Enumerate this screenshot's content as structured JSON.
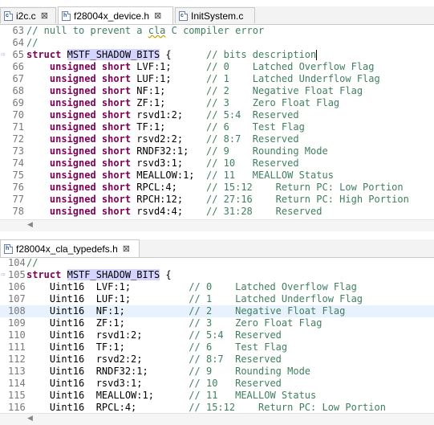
{
  "top_tabs": [
    {
      "label": "i2c.c",
      "icon": "c-file-icon",
      "has_close": true,
      "active": false
    },
    {
      "label": "f28004x_device.h",
      "icon": "h-file-icon",
      "has_close": true,
      "active": true
    },
    {
      "label": "InitSystem.c",
      "icon": "c-file-icon",
      "has_close": false,
      "active": false
    }
  ],
  "bottom_tab": {
    "label": "f28004x_cla_typedefs.h",
    "icon": "h-file-icon",
    "has_close": true
  },
  "close_glyph": "⊠",
  "top_editor": [
    {
      "n": "63",
      "parts": [
        [
          "cm",
          "// null to prevent a "
        ],
        [
          "cmsq",
          "cla"
        ],
        [
          "cm",
          " C compiler error"
        ]
      ]
    },
    {
      "n": "64",
      "parts": [
        [
          "cm",
          "//"
        ]
      ]
    },
    {
      "n": "65",
      "marker": true,
      "parts": [
        [
          "kw",
          "struct"
        ],
        [
          "",
          " "
        ],
        [
          "sel",
          "MSTF_SHADOW_BITS"
        ],
        [
          "",
          " {      "
        ],
        [
          "cm",
          "// bits description"
        ],
        [
          "caret",
          ""
        ]
      ]
    },
    {
      "n": "66",
      "parts": [
        [
          "",
          "    "
        ],
        [
          "kw",
          "unsigned short"
        ],
        [
          "",
          " LVF:1;      "
        ],
        [
          "cm",
          "// 0    Latched Overflow Flag"
        ]
      ]
    },
    {
      "n": "67",
      "parts": [
        [
          "",
          "    "
        ],
        [
          "kw",
          "unsigned short"
        ],
        [
          "",
          " LUF:1;      "
        ],
        [
          "cm",
          "// 1    Latched Underflow Flag"
        ]
      ]
    },
    {
      "n": "68",
      "parts": [
        [
          "",
          "    "
        ],
        [
          "kw",
          "unsigned short"
        ],
        [
          "",
          " NF:1;       "
        ],
        [
          "cm",
          "// 2    Negative Float Flag"
        ]
      ]
    },
    {
      "n": "69",
      "parts": [
        [
          "",
          "    "
        ],
        [
          "kw",
          "unsigned short"
        ],
        [
          "",
          " ZF:1;       "
        ],
        [
          "cm",
          "// 3    Zero Float Flag"
        ]
      ]
    },
    {
      "n": "70",
      "parts": [
        [
          "",
          "    "
        ],
        [
          "kw",
          "unsigned short"
        ],
        [
          "",
          " rsvd1:2;    "
        ],
        [
          "cm",
          "// 5:4  Reserved"
        ]
      ]
    },
    {
      "n": "71",
      "parts": [
        [
          "",
          "    "
        ],
        [
          "kw",
          "unsigned short"
        ],
        [
          "",
          " TF:1;       "
        ],
        [
          "cm",
          "// 6    Test Flag"
        ]
      ]
    },
    {
      "n": "72",
      "parts": [
        [
          "",
          "    "
        ],
        [
          "kw",
          "unsigned short"
        ],
        [
          "",
          " rsvd2:2;    "
        ],
        [
          "cm",
          "// 8:7  Reserved"
        ]
      ]
    },
    {
      "n": "73",
      "parts": [
        [
          "",
          "    "
        ],
        [
          "kw",
          "unsigned short"
        ],
        [
          "",
          " RNDF32:1;   "
        ],
        [
          "cm",
          "// 9    Rounding Mode"
        ]
      ]
    },
    {
      "n": "74",
      "parts": [
        [
          "",
          "    "
        ],
        [
          "kw",
          "unsigned short"
        ],
        [
          "",
          " rsvd3:1;    "
        ],
        [
          "cm",
          "// 10   Reserved"
        ]
      ]
    },
    {
      "n": "75",
      "parts": [
        [
          "",
          "    "
        ],
        [
          "kw",
          "unsigned short"
        ],
        [
          "",
          " MEALLOW:1;  "
        ],
        [
          "cm",
          "// 11   MEALLOW Status"
        ]
      ]
    },
    {
      "n": "76",
      "parts": [
        [
          "",
          "    "
        ],
        [
          "kw",
          "unsigned short"
        ],
        [
          "",
          " RPCL:4;     "
        ],
        [
          "cm",
          "// 15:12    Return PC: Low Portion"
        ]
      ]
    },
    {
      "n": "77",
      "parts": [
        [
          "",
          "    "
        ],
        [
          "kw",
          "unsigned short"
        ],
        [
          "",
          " RPCH:12;    "
        ],
        [
          "cm",
          "// 27:16    Return PC: High Portion"
        ]
      ]
    },
    {
      "n": "78",
      "parts": [
        [
          "",
          "    "
        ],
        [
          "kw",
          "unsigned short"
        ],
        [
          "",
          " rsvd4:4;    "
        ],
        [
          "cm",
          "// 31:28    Reserved"
        ]
      ]
    }
  ],
  "bottom_editor": [
    {
      "n": "104",
      "parts": [
        [
          "cm",
          "//"
        ]
      ]
    },
    {
      "n": "105",
      "marker": true,
      "parts": [
        [
          "kw",
          "struct"
        ],
        [
          "",
          " "
        ],
        [
          "sel",
          "MSTF_SHADOW_BITS"
        ],
        [
          "",
          " {"
        ]
      ]
    },
    {
      "n": "106",
      "parts": [
        [
          "",
          "    Uint16  LVF:1;          "
        ],
        [
          "cm",
          "// 0    Latched Overflow Flag"
        ]
      ]
    },
    {
      "n": "107",
      "parts": [
        [
          "",
          "    Uint16  LUF:1;          "
        ],
        [
          "cm",
          "// 1    Latched Underflow Flag"
        ]
      ]
    },
    {
      "n": "108",
      "hl": true,
      "parts": [
        [
          "",
          "    Uint16  NF:1;           "
        ],
        [
          "cm",
          "// 2    Negative Float Flag"
        ]
      ]
    },
    {
      "n": "109",
      "parts": [
        [
          "",
          "    Uint16  ZF:1;           "
        ],
        [
          "cm",
          "// 3    Zero Float Flag"
        ]
      ]
    },
    {
      "n": "110",
      "parts": [
        [
          "",
          "    Uint16  rsvd1:2;        "
        ],
        [
          "cm",
          "// 5:4  Reserved"
        ]
      ]
    },
    {
      "n": "111",
      "parts": [
        [
          "",
          "    Uint16  TF:1;           "
        ],
        [
          "cm",
          "// 6    Test Flag"
        ]
      ]
    },
    {
      "n": "112",
      "parts": [
        [
          "",
          "    Uint16  rsvd2:2;        "
        ],
        [
          "cm",
          "// 8:7  Reserved"
        ]
      ]
    },
    {
      "n": "113",
      "parts": [
        [
          "",
          "    Uint16  RNDF32:1;       "
        ],
        [
          "cm",
          "// 9    Rounding Mode"
        ]
      ]
    },
    {
      "n": "114",
      "parts": [
        [
          "",
          "    Uint16  rsvd3:1;        "
        ],
        [
          "cm",
          "// 10   Reserved"
        ]
      ]
    },
    {
      "n": "115",
      "parts": [
        [
          "",
          "    Uint16  MEALLOW:1;      "
        ],
        [
          "cm",
          "// 11   MEALLOW Status"
        ]
      ]
    },
    {
      "n": "116",
      "parts": [
        [
          "",
          "    Uint16  RPCL:4;         "
        ],
        [
          "cm",
          "// 15:12    Return PC: Low Portion"
        ]
      ]
    }
  ],
  "scroll_arrow": "◀"
}
